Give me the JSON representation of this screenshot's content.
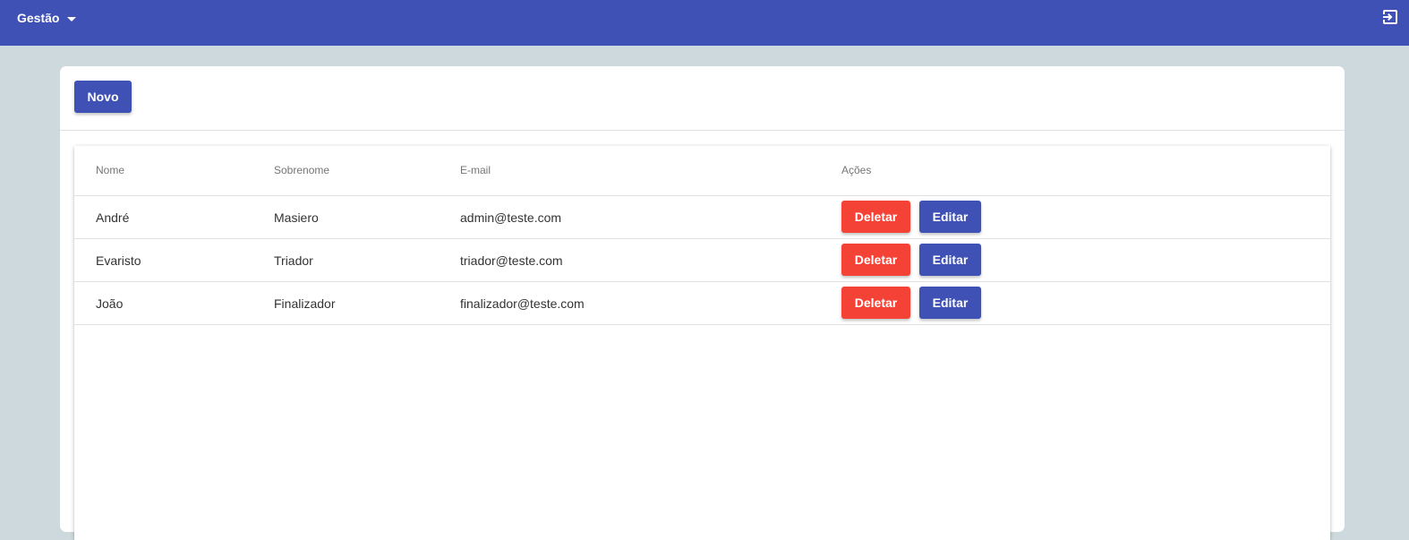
{
  "header": {
    "menu_label": "Gestão",
    "menu_icon": "chevron-down-icon",
    "logout_icon": "exit-to-app-icon"
  },
  "toolbar": {
    "new_label": "Novo"
  },
  "table": {
    "columns": [
      "Nome",
      "Sobrenome",
      "E-mail",
      "Ações"
    ],
    "rows": [
      {
        "nome": "André",
        "sobrenome": "Masiero",
        "email": "admin@teste.com",
        "delete_label": "Deletar",
        "edit_label": "Editar"
      },
      {
        "nome": "Evaristo",
        "sobrenome": "Triador",
        "email": "triador@teste.com",
        "delete_label": "Deletar",
        "edit_label": "Editar"
      },
      {
        "nome": "João",
        "sobrenome": "Finalizador",
        "email": "finalizador@teste.com",
        "delete_label": "Deletar",
        "edit_label": "Editar"
      }
    ]
  },
  "colors": {
    "primary": "#3f51b5",
    "danger": "#f44336",
    "background": "#cdd9dc"
  }
}
